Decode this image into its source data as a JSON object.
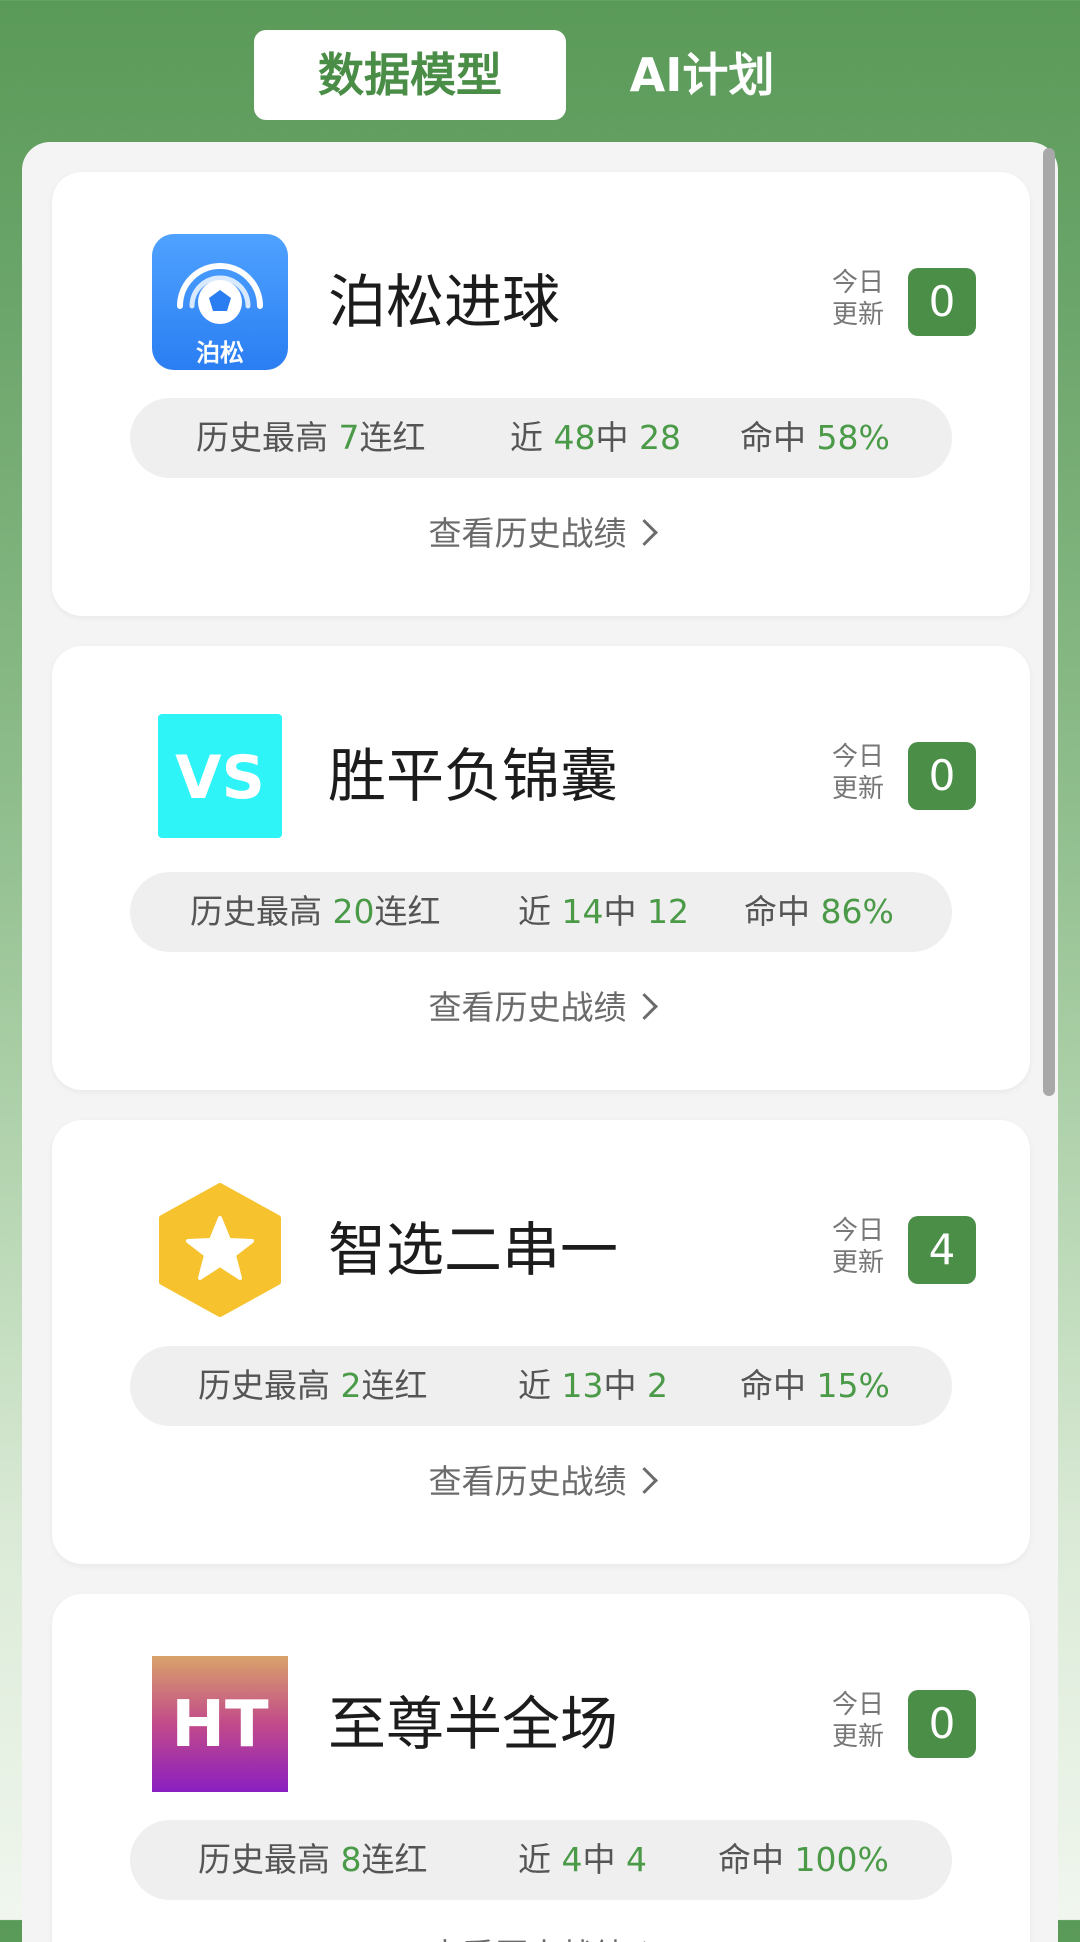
{
  "tabs": [
    {
      "label": "数据模型",
      "active": true
    },
    {
      "label": "AI计划",
      "active": false
    }
  ],
  "today_label": [
    "今日",
    "更新"
  ],
  "history_link_label": "查看历史战绩",
  "stat_labels": {
    "streak_prefix": "历史最高",
    "streak_suffix": "连红",
    "recent_prefix": "近",
    "recent_mid": "中",
    "hit_prefix": "命中"
  },
  "cards": [
    {
      "title": "泊松进球",
      "icon": "poisson-soccer-icon",
      "icon_text": "泊松",
      "today_count": "0",
      "streak": "7",
      "recent_total": "48",
      "recent_hits": "28",
      "hit_rate": "58%"
    },
    {
      "title": "胜平负锦囊",
      "icon": "vs-icon",
      "icon_text": "VS",
      "today_count": "0",
      "streak": "20",
      "recent_total": "14",
      "recent_hits": "12",
      "hit_rate": "86%"
    },
    {
      "title": "智选二串一",
      "icon": "star-hexagon-icon",
      "today_count": "4",
      "streak": "2",
      "recent_total": "13",
      "recent_hits": "2",
      "hit_rate": "15%"
    },
    {
      "title": "至尊半全场",
      "icon": "ht-icon",
      "icon_text": "HT",
      "today_count": "0",
      "streak": "8",
      "recent_total": "4",
      "recent_hits": "4",
      "hit_rate": "100%"
    }
  ],
  "colors": {
    "accent_green": "#4b8e48",
    "stat_green": "#4a9a48",
    "vs_cyan": "#2ef3f7",
    "star_yellow": "#f6c32f",
    "poisson_blue": "#3a8ef6"
  }
}
